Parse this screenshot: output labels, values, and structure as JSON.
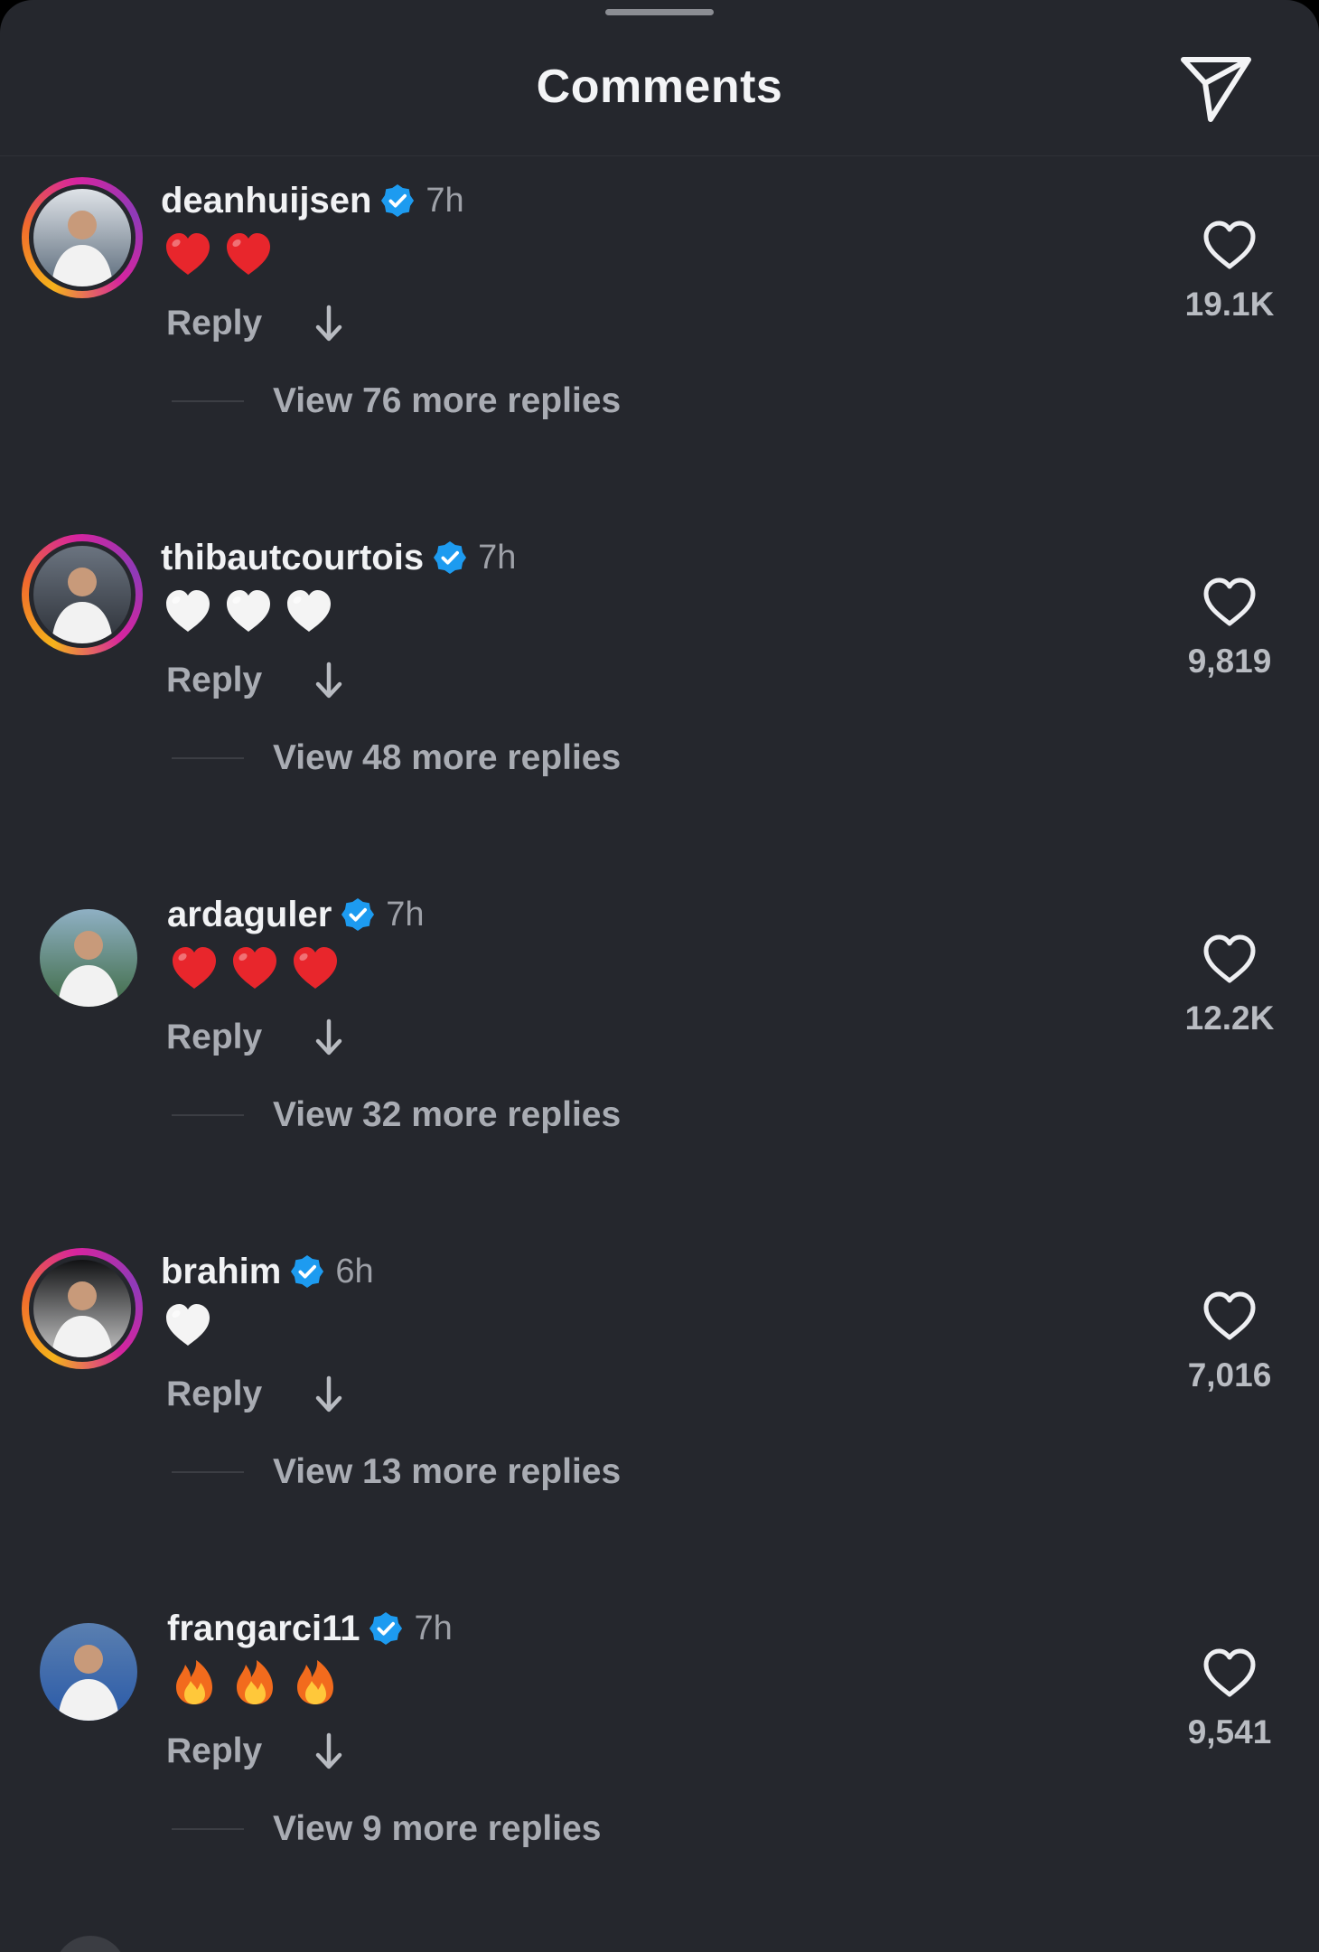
{
  "header": {
    "title": "Comments",
    "share_icon": "paper-plane-icon"
  },
  "comments": [
    {
      "username": "deanhuijsen",
      "verified": true,
      "time": "7h",
      "emojis": [
        "❤️",
        "❤️"
      ],
      "reply_label": "Reply",
      "view_replies": "View 76 more replies",
      "likes": "19.1K",
      "avatar_ring": true,
      "avatar_colors": [
        "#dfe3e8",
        "#5a6a7a"
      ]
    },
    {
      "username": "thibautcourtois",
      "verified": true,
      "time": "7h",
      "emojis": [
        "🤍",
        "🤍",
        "🤍"
      ],
      "reply_label": "Reply",
      "view_replies": "View 48 more replies",
      "likes": "9,819",
      "avatar_ring": true,
      "avatar_colors": [
        "#6b7480",
        "#2d3138"
      ]
    },
    {
      "username": "ardaguler",
      "verified": true,
      "time": "7h",
      "emojis": [
        "❤️",
        "❤️",
        "❤️"
      ],
      "reply_label": "Reply",
      "view_replies": "View 32 more replies",
      "likes": "12.2K",
      "avatar_ring": false,
      "avatar_colors": [
        "#8fb0c4",
        "#3f6b45"
      ]
    },
    {
      "username": "brahim",
      "verified": true,
      "time": "6h",
      "emojis": [
        "🤍"
      ],
      "reply_label": "Reply",
      "view_replies": "View 13 more replies",
      "likes": "7,016",
      "avatar_ring": true,
      "avatar_colors": [
        "#111214",
        "#c9c9c9"
      ]
    },
    {
      "username": "frangarci11",
      "verified": true,
      "time": "7h",
      "emojis": [
        "🔥",
        "🔥",
        "🔥"
      ],
      "reply_label": "Reply",
      "view_replies": "View 9 more replies",
      "likes": "9,541",
      "avatar_ring": false,
      "avatar_colors": [
        "#5a7fb0",
        "#2a5aa8"
      ]
    }
  ],
  "colors": {
    "background": "#25272d",
    "text_primary": "#f1f2f4",
    "text_secondary": "#a9acb3",
    "verified_blue": "#1d9bf0",
    "heart_red": "#e8262c"
  }
}
